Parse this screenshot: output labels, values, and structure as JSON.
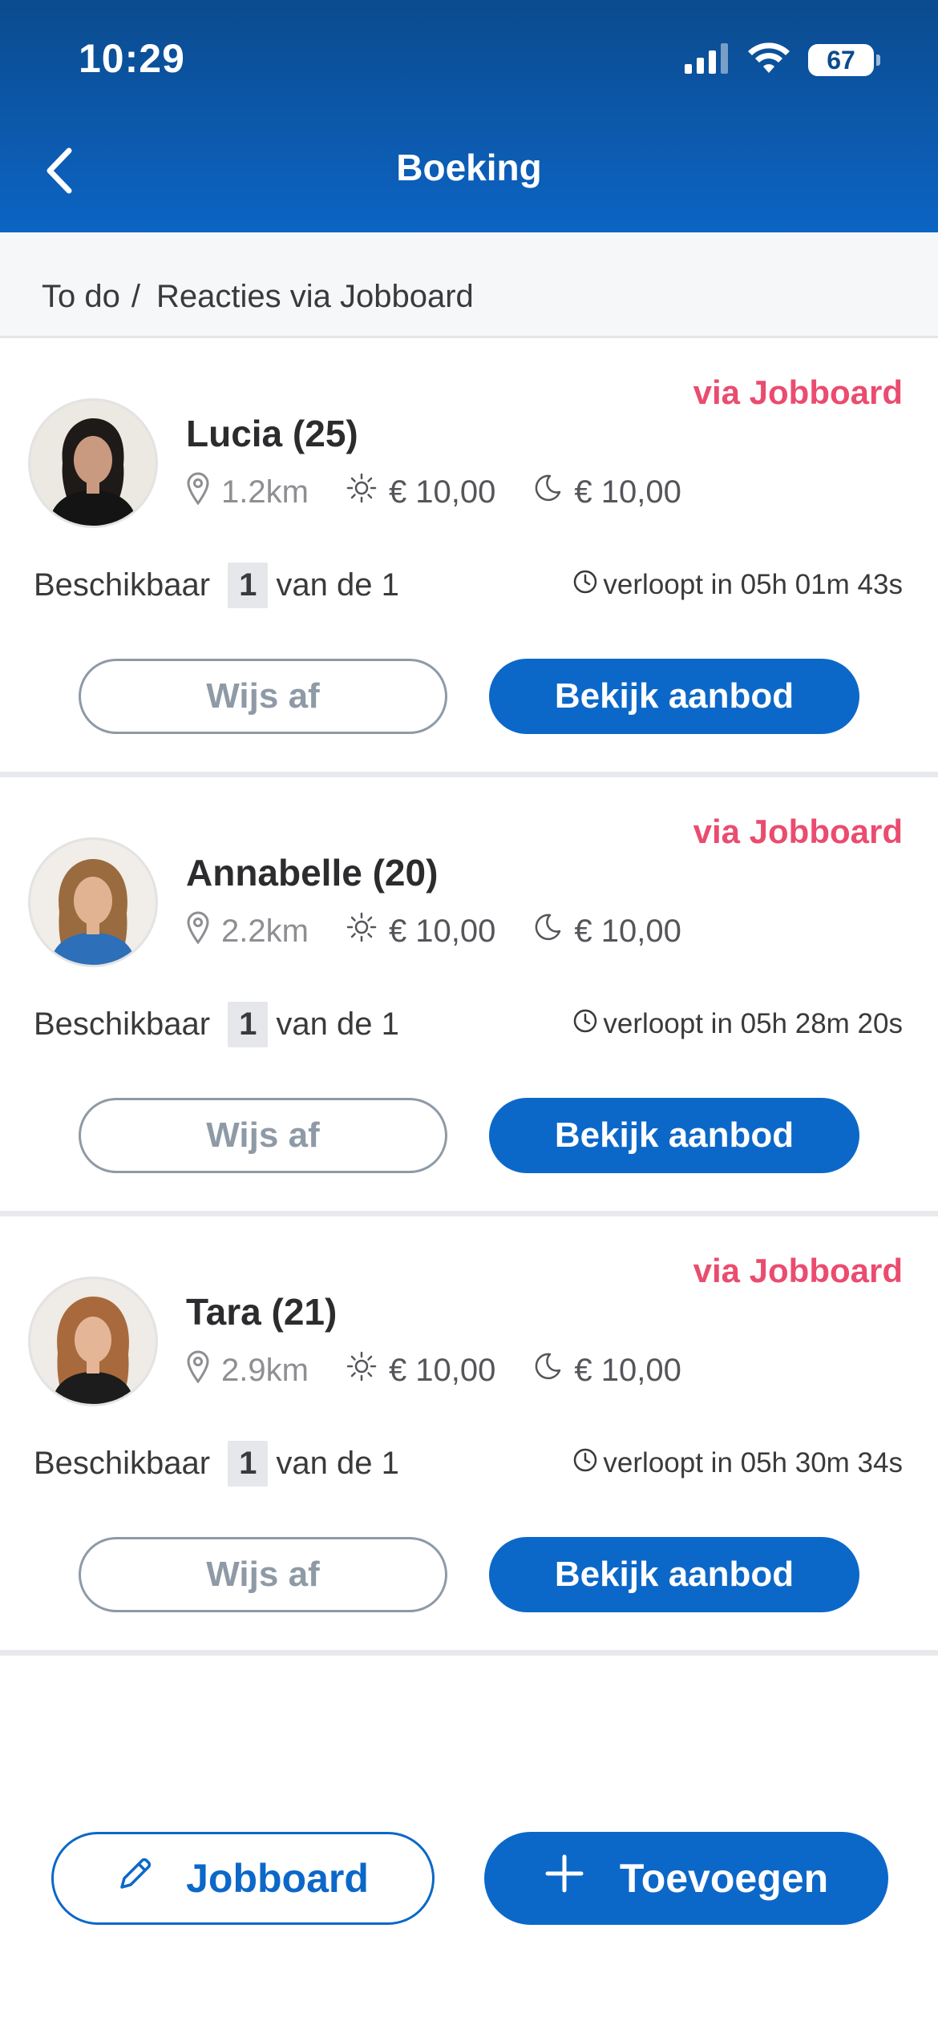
{
  "status_bar": {
    "time": "10:29",
    "battery": "67",
    "icons": [
      "signal-icon",
      "wifi-icon",
      "battery-icon"
    ]
  },
  "header": {
    "title": "Boeking",
    "back_icon": "chevron-left-icon",
    "gradient_top": "#0b4b8e",
    "gradient_bottom": "#0c64c4"
  },
  "breadcrumb": {
    "parent": "To do",
    "separator": "/",
    "current": "Reacties via Jobboard"
  },
  "cards": [
    {
      "tag": "via Jobboard",
      "name": "Lucia (25)",
      "distance": "1.2km",
      "day_rate": "€ 10,00",
      "night_rate": "€ 10,00",
      "available_label": "Beschikbaar",
      "available_count": "1",
      "available_total": "van de 1",
      "expiry": "verloopt in 05h 01m 43s",
      "decline_label": "Wijs af",
      "view_label": "Bekijk aanbod"
    },
    {
      "tag": "via Jobboard",
      "name": "Annabelle (20)",
      "distance": "2.2km",
      "day_rate": "€ 10,00",
      "night_rate": "€ 10,00",
      "available_label": "Beschikbaar",
      "available_count": "1",
      "available_total": "van de 1",
      "expiry": "verloopt in 05h 28m 20s",
      "decline_label": "Wijs af",
      "view_label": "Bekijk aanbod"
    },
    {
      "tag": "via Jobboard",
      "name": "Tara (21)",
      "distance": "2.9km",
      "day_rate": "€ 10,00",
      "night_rate": "€ 10,00",
      "available_label": "Beschikbaar",
      "available_count": "1",
      "available_total": "van de 1",
      "expiry": "verloopt in 05h 30m 34s",
      "decline_label": "Wijs af",
      "view_label": "Bekijk aanbod"
    }
  ],
  "footer": {
    "jobboard_label": "Jobboard",
    "add_label": "Toevoegen"
  },
  "colors": {
    "accent": "#0c68c8",
    "tag": "#ea4c6f",
    "muted": "#8e9aa6"
  }
}
